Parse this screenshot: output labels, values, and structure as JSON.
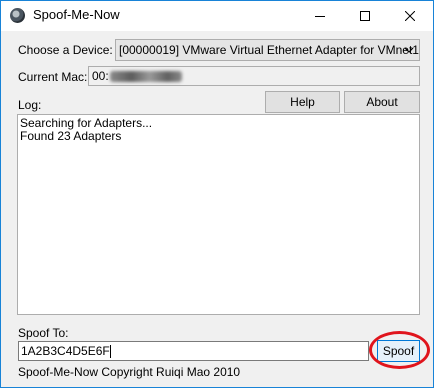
{
  "window": {
    "title": "Spoof-Me-Now"
  },
  "device": {
    "label": "Choose a Device:",
    "selected": "[00000019] VMware Virtual Ethernet Adapter for VMnet1"
  },
  "mac": {
    "label": "Current Mac:",
    "value_prefix": "00:"
  },
  "log": {
    "label": "Log:",
    "lines": [
      "Searching for Adapters...",
      "Found 23 Adapters"
    ]
  },
  "buttons": {
    "help": "Help",
    "about": "About",
    "spoof": "Spoof"
  },
  "spoof_to": {
    "label": "Spoof To:",
    "value": "1A2B3C4D5E6F"
  },
  "footer": {
    "copyright": "Spoof-Me-Now Copyright Ruiqi Mao 2010"
  },
  "colors": {
    "highlight": "#e0141c",
    "focus": "#0078d7"
  }
}
